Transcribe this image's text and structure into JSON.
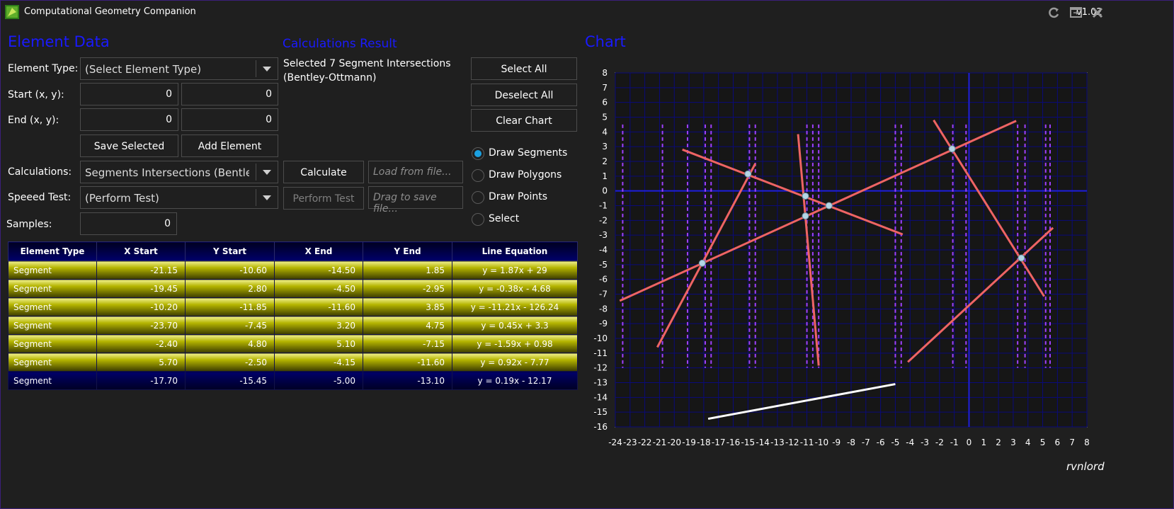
{
  "window": {
    "title": "Computational Geometry Companion",
    "version": "v1.02",
    "icons": [
      "refresh-icon",
      "window-toggle-icon",
      "close-icon"
    ]
  },
  "element_data": {
    "section_title": "Element Data",
    "element_type_label": "Element Type:",
    "element_type_value": "(Select Element Type)",
    "start_label": "Start (x, y):",
    "start_x": "0",
    "start_y": "0",
    "end_label": "End (x, y):",
    "end_x": "0",
    "end_y": "0",
    "save_selected": "Save Selected",
    "add_element": "Add Element",
    "calculations_label": "Calculations:",
    "calculations_value": "Segments Intersections (Bentley-Ottmann)",
    "speed_test_label": "Speeed Test:",
    "speed_test_value": "(Perform Test)",
    "samples_label": "Samples:",
    "samples_value": "0"
  },
  "calculations": {
    "section_title": "Calculations Result",
    "result_text": "Selected 7 Segment Intersections (Bentley-Ottmann)",
    "calculate_button": "Calculate",
    "perform_test_button": "Perform Test",
    "load_placeholder": "Load from file...",
    "save_placeholder": "Drag to save file..."
  },
  "actions": {
    "select_all": "Select All",
    "deselect_all": "Deselect All",
    "clear_chart": "Clear Chart"
  },
  "draw_modes": {
    "selected": "Draw Segments",
    "options": [
      "Draw Segments",
      "Draw Polygons",
      "Draw Points",
      "Select"
    ]
  },
  "table": {
    "headers": [
      "Element Type",
      "X Start",
      "Y Start",
      "X End",
      "Y End",
      "Line Equation"
    ],
    "rows": [
      [
        "Segment",
        "-21.15",
        "-10.60",
        "-14.50",
        "1.85",
        "y = 1.87x + 29"
      ],
      [
        "Segment",
        "-19.45",
        "2.80",
        "-4.50",
        "-2.95",
        "y = -0.38x - 4.68"
      ],
      [
        "Segment",
        "-10.20",
        "-11.85",
        "-11.60",
        "3.85",
        "y = -11.21x - 126.24"
      ],
      [
        "Segment",
        "-23.70",
        "-7.45",
        "3.20",
        "4.75",
        "y = 0.45x + 3.3"
      ],
      [
        "Segment",
        "-2.40",
        "4.80",
        "5.10",
        "-7.15",
        "y = -1.59x + 0.98"
      ],
      [
        "Segment",
        "5.70",
        "-2.50",
        "-4.15",
        "-11.60",
        "y = 0.92x - 7.77"
      ],
      [
        "Segment",
        "-17.70",
        "-15.45",
        "-5.00",
        "-13.10",
        "y = 0.19x - 12.17"
      ]
    ],
    "row_styles": [
      "selected",
      "selected",
      "selected",
      "selected",
      "selected",
      "selected",
      "normal"
    ]
  },
  "chart": {
    "section_title": "Chart",
    "signature": "rvnlord"
  },
  "chart_data": {
    "type": "scatter",
    "xlim": [
      -24,
      8
    ],
    "ylim": [
      -16,
      8
    ],
    "x_ticks": [
      "-24",
      "-23",
      "-22",
      "-21",
      "-20",
      "-19",
      "-18",
      "-17",
      "-16",
      "-15",
      "-14",
      "-13",
      "-12",
      "-11",
      "-10",
      "-9",
      "-8",
      "-7",
      "-6",
      "-5",
      "-4",
      "-3",
      "-2",
      "-1",
      "0",
      "1",
      "2",
      "3",
      "4",
      "5",
      "6",
      "7",
      "8"
    ],
    "y_ticks": [
      "8",
      "7",
      "6",
      "5",
      "4",
      "3",
      "2",
      "1",
      "0",
      "-1",
      "-2",
      "-3",
      "-4",
      "-5",
      "-6",
      "-7",
      "-8",
      "-9",
      "-10",
      "-11",
      "-12",
      "-13",
      "-14",
      "-15",
      "-16"
    ],
    "grid": true,
    "segments": [
      {
        "x1": -21.15,
        "y1": -10.6,
        "x2": -14.5,
        "y2": 1.85,
        "selected": true
      },
      {
        "x1": -19.45,
        "y1": 2.8,
        "x2": -4.5,
        "y2": -2.95,
        "selected": true
      },
      {
        "x1": -10.2,
        "y1": -11.85,
        "x2": -11.6,
        "y2": 3.85,
        "selected": true
      },
      {
        "x1": -23.7,
        "y1": -7.45,
        "x2": 3.2,
        "y2": 4.75,
        "selected": true
      },
      {
        "x1": -2.4,
        "y1": 4.8,
        "x2": 5.1,
        "y2": -7.15,
        "selected": true
      },
      {
        "x1": 5.7,
        "y1": -2.5,
        "x2": -4.15,
        "y2": -11.6,
        "selected": true
      },
      {
        "x1": -17.7,
        "y1": -15.45,
        "x2": -5.0,
        "y2": -13.1,
        "selected": false
      }
    ],
    "intersections": [
      {
        "x": -15.0,
        "y": 1.15
      },
      {
        "x": -11.1,
        "y": -0.35
      },
      {
        "x": -11.1,
        "y": -1.7
      },
      {
        "x": -9.5,
        "y": -1.0
      },
      {
        "x": -18.1,
        "y": -4.9
      },
      {
        "x": -1.15,
        "y": 2.85
      },
      {
        "x": 3.55,
        "y": -4.55
      }
    ],
    "sweep_lines_x": [
      -23.5,
      -20.8,
      -19.1,
      -17.9,
      -17.5,
      -14.9,
      -14.5,
      -11.0,
      -10.6,
      -10.2,
      -5.0,
      -4.6,
      -1.1,
      -0.2,
      3.3,
      3.8,
      5.2,
      5.5
    ],
    "colors": {
      "segment": "#ee6464",
      "unselected_segment": "#ffffff",
      "intersection": "#b4d6e6",
      "sweep": "#a040ff",
      "axis": "#1e1edc",
      "grid": "#0a0a7a"
    }
  }
}
